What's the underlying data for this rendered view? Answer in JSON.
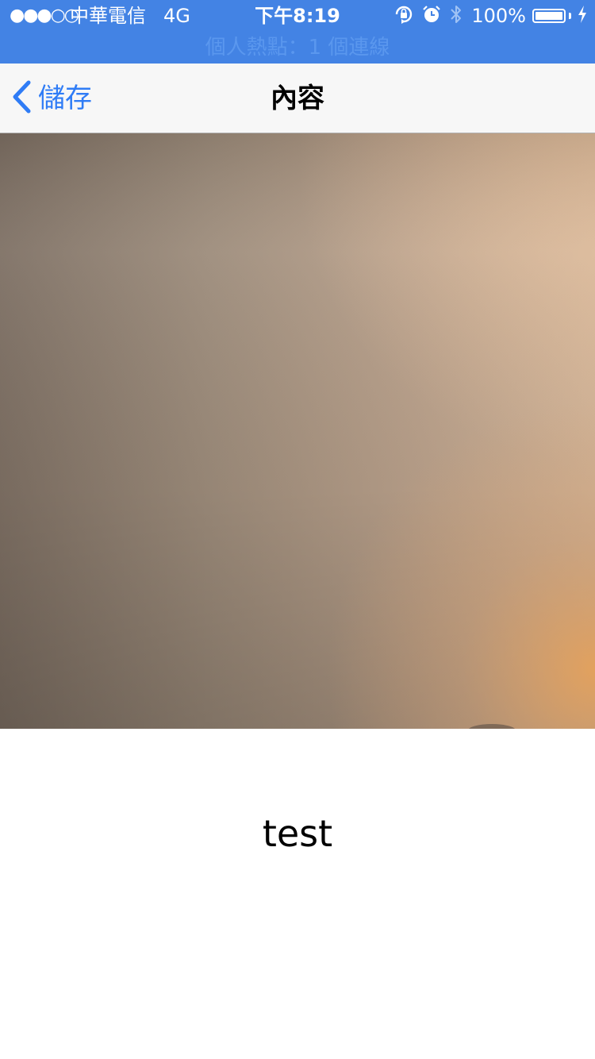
{
  "status_bar": {
    "signal": "●●●○○",
    "carrier": "中華電信",
    "network": "4G",
    "time": "下午8:19",
    "battery_percent": "100%",
    "battery_level": 1.0,
    "icons": [
      "rotation-lock-icon",
      "alarm-icon",
      "bluetooth-icon",
      "battery-icon",
      "charging-icon"
    ],
    "hotspot": "個人熱點：1 個連線",
    "background_color": "#4383e4"
  },
  "nav_bar": {
    "back_label": "儲存",
    "title": "內容",
    "accent_color": "#2f7cf6"
  },
  "content": {
    "text": "test"
  }
}
